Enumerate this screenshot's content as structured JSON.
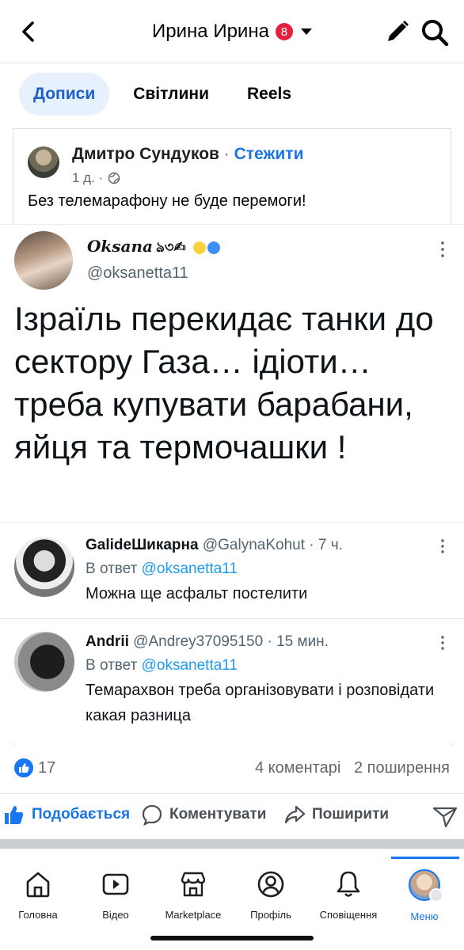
{
  "header": {
    "title": "Ирина Ирина",
    "notification_badge": "8",
    "icons": {
      "back": "back-chevron-icon",
      "edit": "pencil-icon",
      "search": "search-icon"
    }
  },
  "tabs": [
    {
      "label": "Дописи",
      "active": true
    },
    {
      "label": "Світлини",
      "active": false
    },
    {
      "label": "Reels",
      "active": false
    }
  ],
  "post": {
    "author": "Дмитро Сундуков",
    "separator": "·",
    "follow_label": "Стежити",
    "time": "1 д. ·",
    "text": "Без телемарафону не буде перемоги!"
  },
  "tweet": {
    "display_name": "Oksana",
    "name_decoration": "ঌ৩✍︎",
    "handle": "@oksanetta11",
    "body": "Ізраїль перекидає танки до сектору Газа… ідіоти… треба купувати барабани, яйця та термочашки !"
  },
  "replies": [
    {
      "name": "GalideШикарна",
      "handle": "@GalynaKohut",
      "time": "· 7 ч.",
      "reply_prefix": "В ответ",
      "reply_to": "@oksanetta11",
      "text": "Можна ще асфальт постелити"
    },
    {
      "name": "Andrii",
      "handle": "@Andrey37095150",
      "time": "· 15 мин.",
      "reply_prefix": "В ответ",
      "reply_to": "@oksanetta11",
      "text": "Темарахвон треба організовувати і розповідати какая разница"
    }
  ],
  "stats": {
    "likes": "17",
    "comments": "4 коментарі",
    "shares": "2 поширення"
  },
  "actions": {
    "like": "Подобається",
    "comment": "Коментувати",
    "share": "Поширити"
  },
  "bottom_nav": [
    {
      "label": "Головна",
      "icon": "home-icon"
    },
    {
      "label": "Відео",
      "icon": "video-icon"
    },
    {
      "label": "Marketplace",
      "icon": "marketplace-icon"
    },
    {
      "label": "Профіль",
      "icon": "profile-icon"
    },
    {
      "label": "Сповіщення",
      "icon": "bell-icon"
    },
    {
      "label": "Меню",
      "icon": "menu-avatar-icon",
      "active": true
    }
  ],
  "colors": {
    "facebook_blue": "#1877f2",
    "tab_active_bg": "#e7f0fd",
    "badge_red": "#e41e3f",
    "twitter_link": "#1d9bf0"
  }
}
